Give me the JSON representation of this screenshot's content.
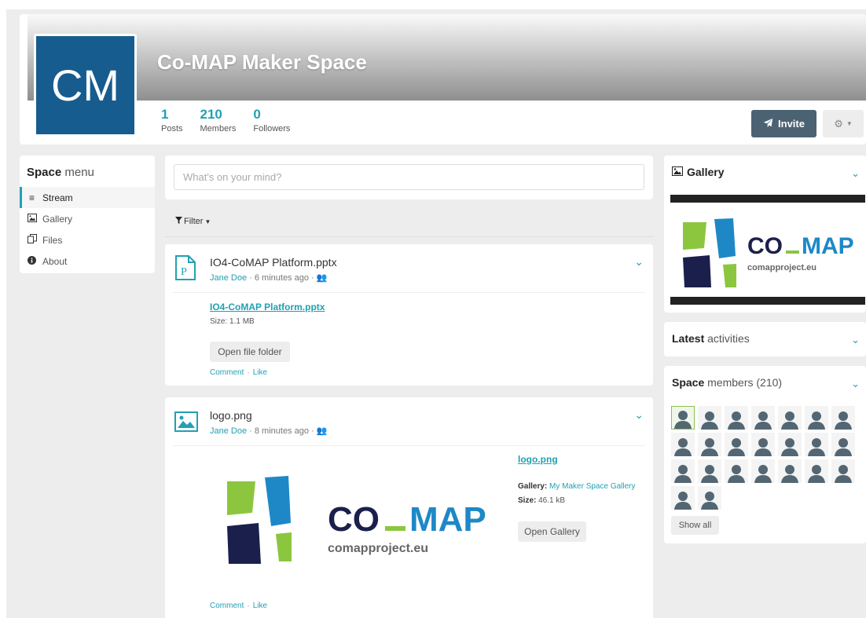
{
  "header": {
    "space_title": "Co-MAP Maker Space",
    "avatar_initials": "CM",
    "stats": [
      {
        "value": "1",
        "label": "Posts"
      },
      {
        "value": "210",
        "label": "Members"
      },
      {
        "value": "0",
        "label": "Followers"
      }
    ],
    "invite_label": "Invite"
  },
  "space_menu": {
    "title_bold": "Space",
    "title_rest": " menu",
    "items": [
      {
        "label": "Stream",
        "icon": "bars-icon",
        "glyph": "≡"
      },
      {
        "label": "Gallery",
        "icon": "image-icon",
        "glyph": "▣"
      },
      {
        "label": "Files",
        "icon": "files-icon",
        "glyph": "⎘"
      },
      {
        "label": "About",
        "icon": "info-icon",
        "glyph": "ℹ"
      }
    ]
  },
  "composer": {
    "placeholder": "What's on your mind?"
  },
  "filter_label": "Filter",
  "posts": [
    {
      "title": "IO4-CoMAP Platform.pptx",
      "author": "Jane Doe",
      "time": " · 6 minutes ago · ",
      "file_link": "IO4-CoMAP Platform.pptx",
      "size": "Size: 1.1 MB",
      "button": "Open file folder",
      "comment": "Comment",
      "like": "Like"
    },
    {
      "title": "logo.png",
      "author": "Jane Doe",
      "time": " · 8 minutes ago · ",
      "file_link": "logo.png",
      "gallery_label": "Gallery:",
      "gallery_value": "My Maker Space Gallery",
      "size_label": "Size:",
      "size_value": "46.1 kB",
      "button": "Open Gallery",
      "comment": "Comment",
      "like": "Like"
    }
  ],
  "logo": {
    "wordmark_co": "CO",
    "wordmark_map": "MAP",
    "url": "comapproject.eu",
    "colors": {
      "navy": "#1b1f4b",
      "green": "#8cc63f",
      "blue": "#1e88c7"
    }
  },
  "right": {
    "gallery_title": "Gallery",
    "latest_bold": "Latest",
    "latest_rest": " activities",
    "members_bold": "Space",
    "members_rest": " members (210)",
    "member_avatar_count": 23,
    "show_all": "Show all"
  },
  "colors": {
    "accent": "#21a1b3",
    "invite_bg": "#4b6273",
    "avatar_bg": "#175c8e"
  }
}
